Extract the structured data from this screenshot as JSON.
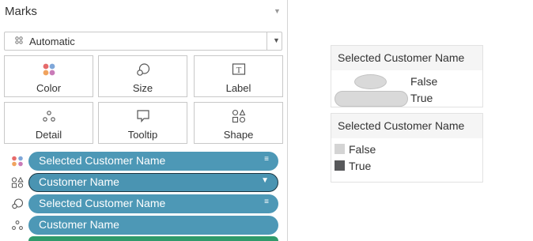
{
  "marks_panel": {
    "title": "Marks",
    "mark_type": "Automatic",
    "cards": [
      {
        "label": "Color"
      },
      {
        "label": "Size"
      },
      {
        "label": "Label"
      },
      {
        "label": "Detail"
      },
      {
        "label": "Tooltip"
      },
      {
        "label": "Shape"
      }
    ],
    "pills": [
      {
        "label": "Selected Customer Name",
        "role": "color"
      },
      {
        "label": "Customer Name",
        "role": "shape"
      },
      {
        "label": "Selected Customer Name",
        "role": "size"
      },
      {
        "label": "Customer Name",
        "role": "detail"
      }
    ]
  },
  "legends": {
    "size_legend": {
      "title": "Selected Customer Name",
      "items": [
        "False",
        "True"
      ]
    },
    "color_legend": {
      "title": "Selected Customer Name",
      "items": [
        {
          "label": "False",
          "color": "#d4d4d4"
        },
        {
          "label": "True",
          "color": "#58595b"
        }
      ]
    }
  },
  "colors": {
    "pill_blue": "#4d98b6",
    "selected_pill_border": "#1b3540",
    "legend_header": "#f5f5f5"
  }
}
